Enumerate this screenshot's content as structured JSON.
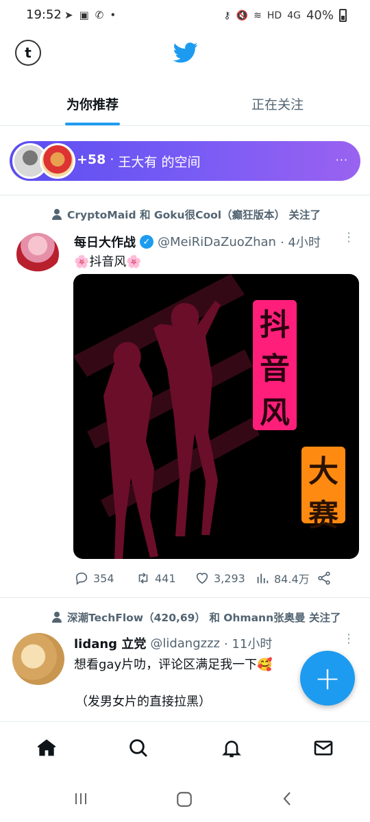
{
  "status_bar": {
    "time": "19:52",
    "left_icons": [
      "telegram-icon",
      "square-icon",
      "missed-call-icon",
      "dot-icon"
    ],
    "right_icons": [
      "key-icon",
      "mute-icon",
      "wifi-icon",
      "hd-icon",
      "4g-signal-icon"
    ],
    "hd": "HD",
    "net": "4G",
    "battery": "40%"
  },
  "header": {
    "avatar_letter": "t",
    "logo": "twitter-bird-icon"
  },
  "tabs": [
    {
      "label": "为你推荐",
      "active": true
    },
    {
      "label": "正在关注",
      "active": false
    }
  ],
  "space": {
    "count": "+58",
    "dot": "·",
    "title": "王大有 的空间",
    "more": "···"
  },
  "tweets": [
    {
      "context": {
        "names": "CryptoMaid 和 Goku很Cool（癫狂版本） 关注了"
      },
      "name": "每日大作战",
      "verified": true,
      "handle": "@MeiRiDaZuoZhan",
      "time": "· 4小时",
      "text": "🌸抖音风🌸",
      "media": {
        "badge_top": [
          "抖",
          "音",
          "风"
        ],
        "badge_bottom": [
          "大",
          "赛"
        ]
      },
      "stats": {
        "replies": "354",
        "retweets": "441",
        "likes": "3,293",
        "views": "84.4万"
      }
    },
    {
      "context": {
        "names": "深潮TechFlow（420,69） 和 Ohmann张奥曼 关注了"
      },
      "name": "lidang 立党",
      "verified": false,
      "handle": "@lidangzzz",
      "time": "· 11小时",
      "text_line1": "想看gay片叻，评论区满足我一下🥰",
      "text_line2": "（发男女片的直接拉黑）"
    }
  ],
  "fab": {
    "label": "+"
  },
  "bottom_nav": [
    "home-icon",
    "search-icon",
    "bell-icon",
    "mail-icon"
  ],
  "colors": {
    "accent": "#1d9bf0",
    "space_start": "#5b4ef0",
    "space_end": "#9a62f0",
    "badge_pink": "#ff1f7a",
    "badge_orange": "#ff8a12"
  }
}
